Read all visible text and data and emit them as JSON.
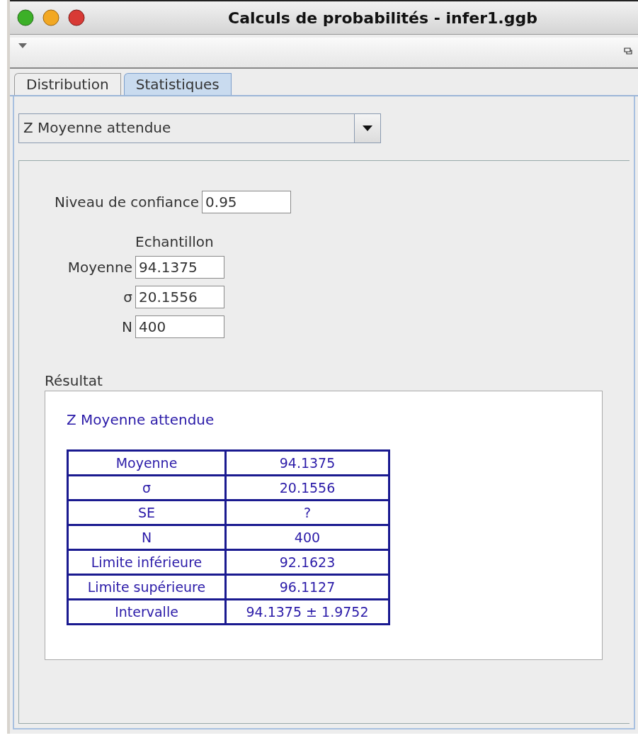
{
  "window": {
    "title": "Calculs de probabilités - infer1.ggb"
  },
  "tabs": [
    {
      "label": "Distribution",
      "selected": false
    },
    {
      "label": "Statistiques",
      "selected": true
    }
  ],
  "procedure_dropdown": {
    "value": "Z Moyenne attendue"
  },
  "confidence": {
    "label": "Niveau de confiance",
    "value": "0.95"
  },
  "sample": {
    "heading": "Echantillon",
    "fields": [
      {
        "label": "Moyenne",
        "value": "94.1375"
      },
      {
        "label": "σ",
        "value": "20.1556"
      },
      {
        "label": "N",
        "value": "400"
      }
    ]
  },
  "result": {
    "label": "Résultat",
    "title": "Z Moyenne attendue",
    "rows": [
      {
        "name": "Moyenne",
        "value": "94.1375"
      },
      {
        "name": "σ",
        "value": "20.1556"
      },
      {
        "name": "SE",
        "value": "?"
      },
      {
        "name": "N",
        "value": "400"
      },
      {
        "name": "Limite inférieure",
        "value": "92.1623"
      },
      {
        "name": "Limite supérieure",
        "value": "96.1127"
      },
      {
        "name": "Intervalle",
        "value": "94.1375 ± 1.9752"
      }
    ]
  }
}
